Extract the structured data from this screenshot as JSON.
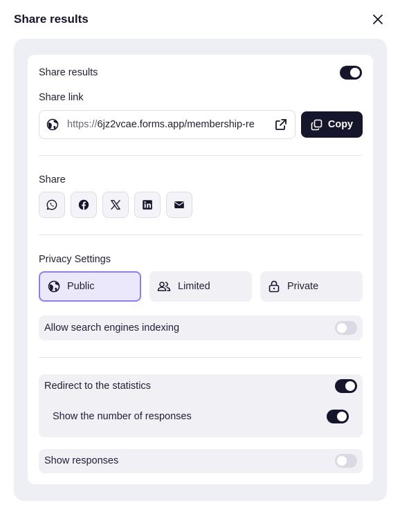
{
  "dialog": {
    "title": "Share results",
    "close_icon": "close-icon"
  },
  "share_results": {
    "label": "Share results",
    "enabled": true
  },
  "share_link": {
    "label": "Share link",
    "url_protocol": "https://",
    "url_rest": "6jz2vcae.forms.app/membership-re",
    "copy_label": "Copy"
  },
  "share": {
    "label": "Share",
    "icons": [
      "whatsapp-icon",
      "facebook-icon",
      "x-icon",
      "linkedin-icon",
      "mail-icon"
    ]
  },
  "privacy": {
    "label": "Privacy Settings",
    "options": [
      {
        "label": "Public",
        "icon": "globe-icon",
        "selected": true
      },
      {
        "label": "Limited",
        "icon": "users-icon",
        "selected": false
      },
      {
        "label": "Private",
        "icon": "lock-icon",
        "selected": false
      }
    ],
    "search_indexing": {
      "label": "Allow search engines indexing",
      "enabled": false
    }
  },
  "statistics": {
    "redirect": {
      "label": "Redirect to the statistics",
      "enabled": true
    },
    "show_count": {
      "label": "Show the number of responses",
      "enabled": true
    }
  },
  "responses": {
    "label": "Show responses",
    "enabled": false
  },
  "colors": {
    "primary": "#15152b",
    "selected_border": "#8b7ff0",
    "selected_bg": "#ebe8fc",
    "panel_bg": "#f0f0f5"
  }
}
